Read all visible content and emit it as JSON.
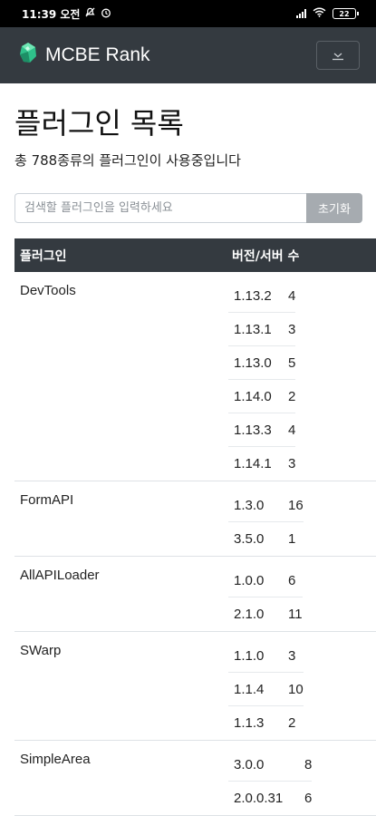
{
  "status_bar": {
    "time": "11:39 오전",
    "battery": "22"
  },
  "navbar": {
    "brand": "MCBE Rank"
  },
  "page": {
    "title": "플러그인 목록",
    "summary": "총 788종류의 플러그인이 사용중입니다"
  },
  "search": {
    "placeholder": "검색할 플러그인을 입력하세요",
    "value": "",
    "reset_label": "초기화"
  },
  "table": {
    "headers": {
      "plugin": "플러그인",
      "version_servers": "버전/서버 수"
    },
    "rows": [
      {
        "name": "DevTools",
        "versions": [
          {
            "version": "1.13.2",
            "servers": "4"
          },
          {
            "version": "1.13.1",
            "servers": "3"
          },
          {
            "version": "1.13.0",
            "servers": "5"
          },
          {
            "version": "1.14.0",
            "servers": "2"
          },
          {
            "version": "1.13.3",
            "servers": "4"
          },
          {
            "version": "1.14.1",
            "servers": "3"
          }
        ]
      },
      {
        "name": "FormAPI",
        "versions": [
          {
            "version": "1.3.0",
            "servers": "16"
          },
          {
            "version": "3.5.0",
            "servers": "1"
          }
        ]
      },
      {
        "name": "AllAPILoader",
        "versions": [
          {
            "version": "1.0.0",
            "servers": "6"
          },
          {
            "version": "2.1.0",
            "servers": "11"
          }
        ]
      },
      {
        "name": "SWarp",
        "versions": [
          {
            "version": "1.1.0",
            "servers": "3"
          },
          {
            "version": "1.1.4",
            "servers": "10"
          },
          {
            "version": "1.1.3",
            "servers": "2"
          }
        ]
      },
      {
        "name": "SimpleArea",
        "versions": [
          {
            "version": "3.0.0",
            "servers": "8"
          },
          {
            "version": "2.0.0.31",
            "servers": "6"
          }
        ]
      }
    ]
  }
}
